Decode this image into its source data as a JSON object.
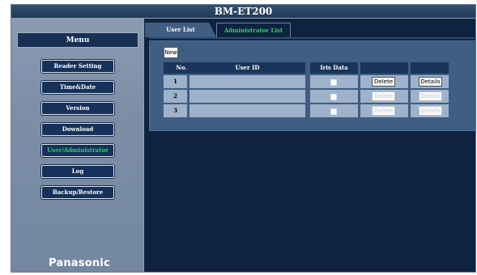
{
  "window": {
    "title": "BM-ET200"
  },
  "sidebar": {
    "header": "Menu",
    "items": [
      {
        "label": "Reader Setting",
        "active": false
      },
      {
        "label": "Time&Date",
        "active": false
      },
      {
        "label": "Version",
        "active": false
      },
      {
        "label": "Download",
        "active": false
      },
      {
        "label": "User/Administrator",
        "active": true
      },
      {
        "label": "Log",
        "active": false
      },
      {
        "label": "Backup/Restore",
        "active": false
      }
    ],
    "logo": "Panasonic"
  },
  "tabs": [
    {
      "label": "User List",
      "active": false
    },
    {
      "label": "Administrator List",
      "active": true
    }
  ],
  "actions": {
    "new_label": "New"
  },
  "table": {
    "headers": [
      "No.",
      "User ID",
      "Iris Data",
      "",
      ""
    ],
    "rows": [
      {
        "no": "1",
        "user_id": "",
        "delete": "Delete",
        "details": "Details",
        "enabled": true
      },
      {
        "no": "2",
        "user_id": "",
        "delete": "Delete",
        "details": "Details",
        "enabled": false
      },
      {
        "no": "3",
        "user_id": "",
        "delete": "Delete",
        "details": "Details",
        "enabled": false
      }
    ]
  },
  "colors": {
    "active_text": "#28d35b",
    "window_bg": "#0f2340",
    "sidebar_bg": "#7d8fa7",
    "panel_bg": "#405d82"
  }
}
